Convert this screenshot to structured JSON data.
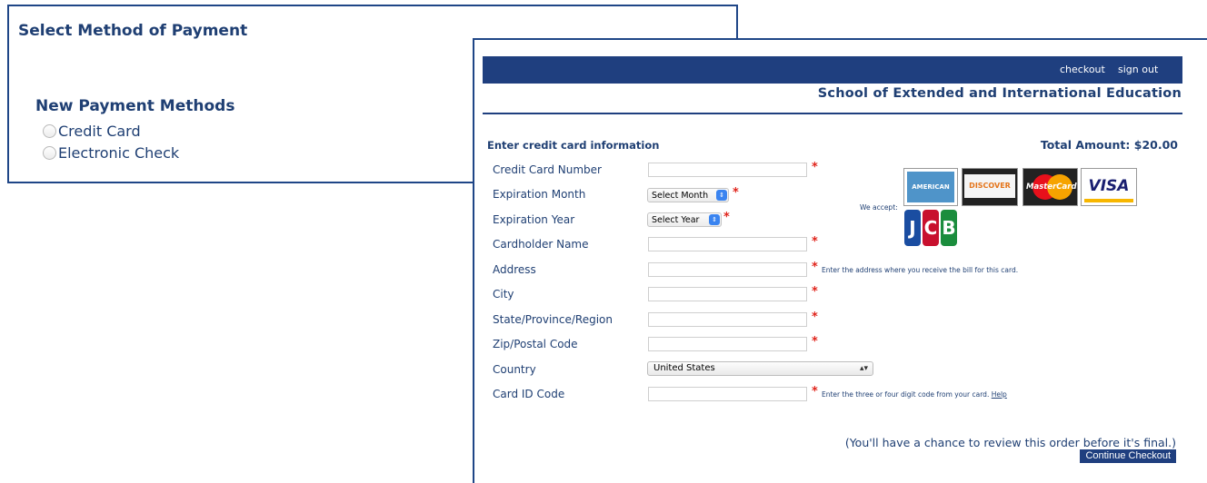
{
  "left_panel": {
    "title": "Select Method of Payment",
    "new_methods_title": "New Payment Methods",
    "options": [
      {
        "label": "Credit Card",
        "selected": false
      },
      {
        "label": "Electronic Check",
        "selected": false
      }
    ]
  },
  "right_panel": {
    "topbar_links": {
      "checkout": "checkout",
      "sign_out": "sign out"
    },
    "school_title": "School of Extended and International Education",
    "form_heading": "Enter credit card information",
    "total_amount": "Total Amount: $20.00",
    "required_marker": "*",
    "fields": {
      "card_number": {
        "label": "Credit Card Number",
        "value": ""
      },
      "expiration_month": {
        "label": "Expiration Month",
        "selected": "Select Month"
      },
      "expiration_year": {
        "label": "Expiration Year",
        "selected": "Select Year"
      },
      "cardholder_name": {
        "label": "Cardholder Name",
        "value": ""
      },
      "address": {
        "label": "Address",
        "value": "",
        "hint": "Enter the address where you receive the bill for this card."
      },
      "city": {
        "label": "City",
        "value": ""
      },
      "state": {
        "label": "State/Province/Region",
        "value": ""
      },
      "zip": {
        "label": "Zip/Postal Code",
        "value": ""
      },
      "country": {
        "label": "Country",
        "selected": "United States"
      },
      "card_id": {
        "label": "Card ID Code",
        "value": "",
        "hint": "Enter the three or four digit code from your card.",
        "help_link": "Help"
      }
    },
    "we_accept": "We accept:",
    "card_logos": {
      "amex": "AMERICAN EXPRESS Cards",
      "discover": "DISCOVER",
      "mastercard": "MasterCard",
      "visa": "VISA",
      "jcb": [
        "J",
        "C",
        "B"
      ]
    },
    "footer_note": "(You'll have a chance to review this order before it's final.)",
    "continue_button": "Continue Checkout"
  },
  "colors": {
    "brand_navy": "#1f3f7f",
    "label_text": "#1f3f73",
    "required_red": "#e0241b"
  }
}
